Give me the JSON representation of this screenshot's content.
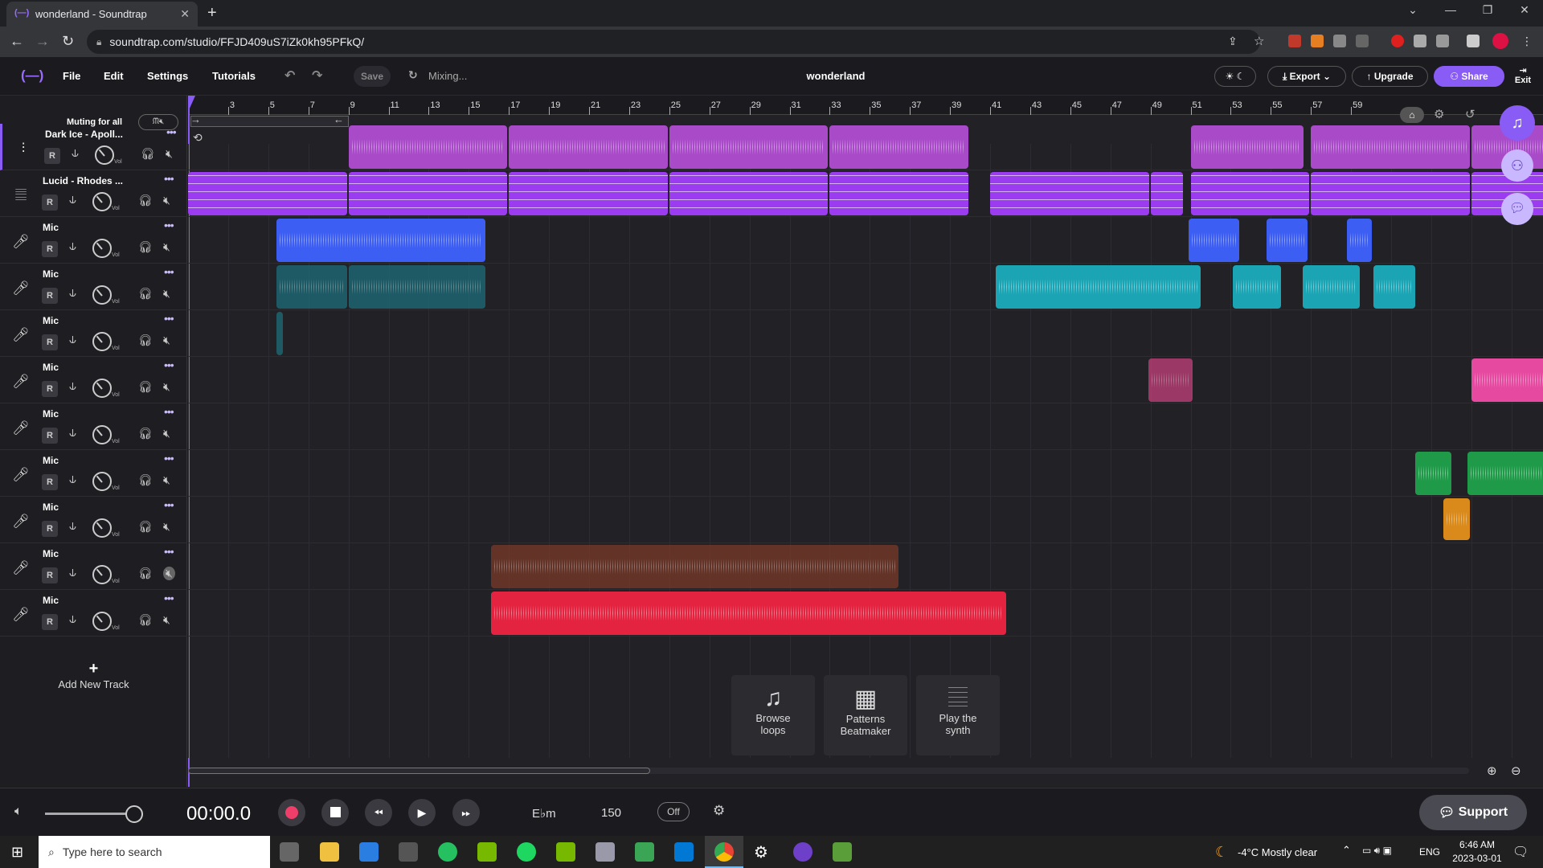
{
  "browser": {
    "tab_title": "wonderland - Soundtrap",
    "url": "soundtrap.com/studio/FFJD409uS7iZk0kh95PFkQ/"
  },
  "app": {
    "menu": [
      "File",
      "Edit",
      "Settings",
      "Tutorials"
    ],
    "save_label": "Save",
    "status": "Mixing...",
    "project_title": "wonderland",
    "export_label": "Export",
    "upgrade_label": "Upgrade",
    "share_label": "Share",
    "exit_label": "Exit",
    "muting_label": "Muting for all"
  },
  "tracks": [
    {
      "name": "Dark Ice - Apoll...",
      "icon": "waveform-icon"
    },
    {
      "name": "Lucid - Rhodes ...",
      "icon": "keyboard-icon"
    },
    {
      "name": "Mic",
      "icon": "mic-icon"
    },
    {
      "name": "Mic",
      "icon": "mic-icon"
    },
    {
      "name": "Mic",
      "icon": "mic-icon"
    },
    {
      "name": "Mic",
      "icon": "mic-icon"
    },
    {
      "name": "Mic",
      "icon": "mic-icon"
    },
    {
      "name": "Mic",
      "icon": "mic-icon"
    },
    {
      "name": "Mic",
      "icon": "mic-icon"
    },
    {
      "name": "Mic",
      "icon": "mic-icon"
    },
    {
      "name": "Mic",
      "icon": "mic-icon"
    }
  ],
  "track_controls": {
    "record": "R",
    "volume": "Vol"
  },
  "add_track_label": "Add New Track",
  "ruler_ticks": [
    "3",
    "5",
    "7",
    "9",
    "11",
    "13",
    "15",
    "17",
    "19",
    "21",
    "23",
    "25",
    "27",
    "29",
    "31",
    "33",
    "35",
    "37",
    "39",
    "41",
    "43",
    "45",
    "47",
    "49",
    "51",
    "53",
    "55",
    "57",
    "59"
  ],
  "tools": [
    {
      "line1": "Browse",
      "line2": "loops",
      "icon": "music-note-icon"
    },
    {
      "line1": "Patterns",
      "line2": "Beatmaker",
      "icon": "grid-icon"
    },
    {
      "line1": "Play the",
      "line2": "synth",
      "icon": "piano-icon"
    }
  ],
  "transport": {
    "time": "00:00.0",
    "key": "E♭m",
    "tempo": "150",
    "metronome": "Off",
    "support": "Support"
  },
  "taskbar": {
    "search_placeholder": "Type here to search",
    "weather": "-4°C  Mostly clear",
    "lang": "ENG",
    "time": "6:46 AM",
    "date": "2023-03-01"
  },
  "colors": {
    "purple": "#a94bc9",
    "violet": "#9b3cf0",
    "blue": "#3d5ef2",
    "teal": "#1aa4b4",
    "darkteal": "#1d6e7a",
    "pink": "#c6407a",
    "magenta": "#e64aa0",
    "green": "#1f9a48",
    "orange": "#d98a1a",
    "brown": "#7a3a28",
    "red": "#e3233f"
  }
}
